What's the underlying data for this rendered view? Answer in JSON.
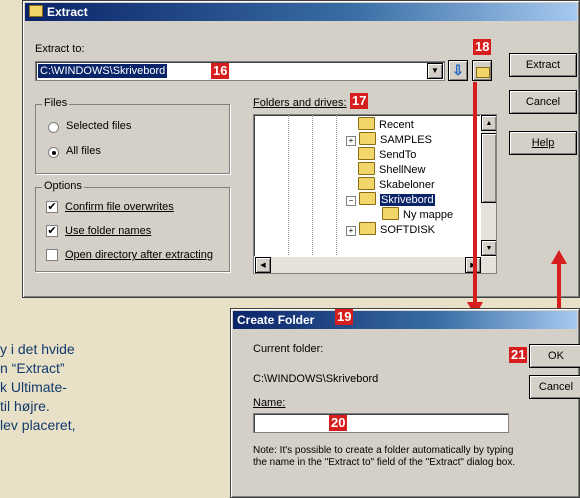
{
  "colors": {
    "accent": "#d71e1e",
    "title_bar": "#0a246a",
    "page_background": "#e8e1c7"
  },
  "extract_window": {
    "title": "Extract",
    "extract_to_label": "Extract to:",
    "extract_to_value": "C:\\WINDOWS\\Skrivebord",
    "folders_label": "Folders and drives:",
    "files_group": {
      "label": "Files",
      "options": [
        "Selected files",
        "All files"
      ],
      "selected": "All files"
    },
    "options_group": {
      "label": "Options",
      "items": [
        {
          "label": "Confirm file overwrites",
          "checked": true
        },
        {
          "label": "Use folder names",
          "checked": true
        },
        {
          "label": "Open directory after extracting",
          "checked": false
        }
      ]
    },
    "tree_items": [
      "Recent",
      "SAMPLES",
      "SendTo",
      "ShellNew",
      "Skabeloner",
      "Skrivebord",
      "Ny mappe",
      "SOFTDISK"
    ],
    "buttons": {
      "extract": "Extract",
      "cancel": "Cancel",
      "help": "Help"
    },
    "icons": {
      "browse": "arrow-down-icon",
      "new_folder": "new-folder-icon",
      "dropdown": "chevron-down-icon"
    }
  },
  "create_folder_window": {
    "title": "Create Folder",
    "current_folder_label": "Current folder:",
    "current_folder_value": "C:\\WINDOWS\\Skrivebord",
    "name_label": "Name:",
    "name_value": "",
    "note": "Note: It's possible to create a folder automatically by typing the name in the \"Extract to\" field of the \"Extract\" dialog box.",
    "buttons": {
      "ok": "OK",
      "cancel": "Cancel"
    }
  },
  "callouts": [
    "16",
    "17",
    "18",
    "19",
    "20",
    "21"
  ],
  "article_text": [
    "y i det hvide",
    "n “Extract”",
    "k Ultimate-",
    "til højre.",
    "lev placeret,",
    ""
  ]
}
